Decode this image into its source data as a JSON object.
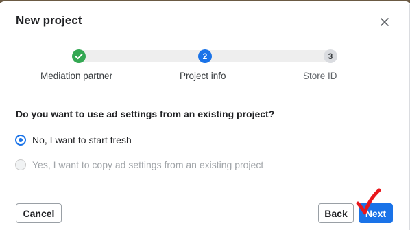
{
  "dialog": {
    "title": "New project",
    "close_icon": "close-icon"
  },
  "stepper": {
    "steps": [
      {
        "label": "Mediation partner",
        "marker": "check-icon",
        "state": "completed",
        "color": "#34a853"
      },
      {
        "label": "Project info",
        "number": "2",
        "state": "current",
        "color": "#1a73e8"
      },
      {
        "label": "Store ID",
        "number": "3",
        "state": "upcoming",
        "color": "#dadce0"
      }
    ]
  },
  "question": "Do you want to use ad settings from an existing project?",
  "options": [
    {
      "label": "No, I want to start fresh",
      "selected": true,
      "disabled": false
    },
    {
      "label": "Yes, I want to copy ad settings from an existing project",
      "selected": false,
      "disabled": true
    }
  ],
  "footer": {
    "cancel_label": "Cancel",
    "back_label": "Back",
    "next_label": "Next"
  },
  "annotation": {
    "icon": "red-checkmark-icon",
    "color": "#e8171c"
  },
  "colors": {
    "accent": "#1a73e8",
    "success": "#34a853"
  }
}
